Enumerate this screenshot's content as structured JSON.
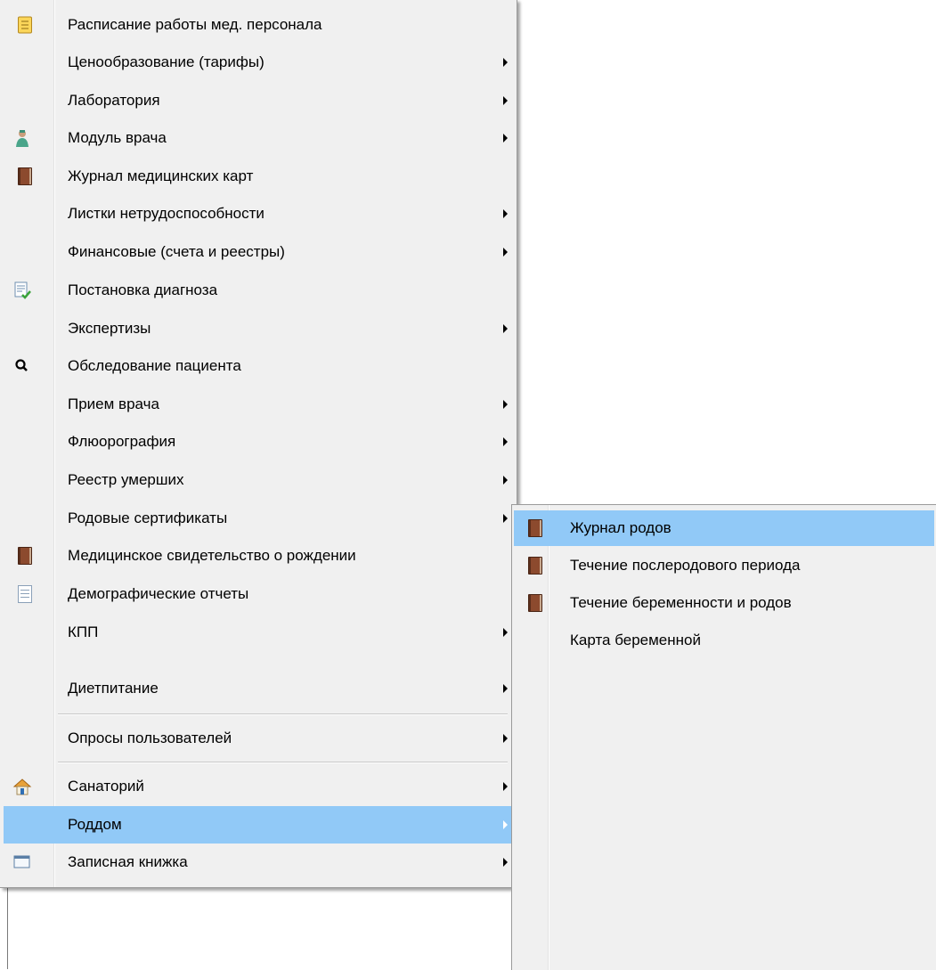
{
  "main_menu": {
    "items": [
      {
        "label": "Расписание работы мед. персонала",
        "icon": "notepad-icon",
        "submenu": false
      },
      {
        "label": "Ценообразование (тарифы)",
        "icon": "",
        "submenu": true
      },
      {
        "label": "Лаборатория",
        "icon": "",
        "submenu": true
      },
      {
        "label": "Модуль врача",
        "icon": "doctor-icon",
        "submenu": true
      },
      {
        "label": "Журнал медицинских карт",
        "icon": "book-icon",
        "submenu": false
      },
      {
        "label": "Листки нетрудоспособности",
        "icon": "",
        "submenu": true
      },
      {
        "label": "Финансовые (счета и реестры)",
        "icon": "",
        "submenu": true
      },
      {
        "label": "Постановка диагноза",
        "icon": "document-check-icon",
        "submenu": false
      },
      {
        "label": "Экспертизы",
        "icon": "",
        "submenu": true
      },
      {
        "label": "Обследование пациента",
        "icon": "magnifier-icon",
        "submenu": false
      },
      {
        "label": "Прием врача",
        "icon": "",
        "submenu": true
      },
      {
        "label": "Флюорография",
        "icon": "",
        "submenu": true
      },
      {
        "label": "Реестр умерших",
        "icon": "",
        "submenu": true
      },
      {
        "label": "Родовые сертификаты",
        "icon": "",
        "submenu": true
      },
      {
        "label": "Медицинское свидетельство о рождении",
        "icon": "book-icon",
        "submenu": false
      },
      {
        "label": "Демографические отчеты",
        "icon": "document-icon",
        "submenu": false
      },
      {
        "label": "КПП",
        "icon": "",
        "submenu": true
      },
      {
        "label": "Диетпитание",
        "icon": "",
        "submenu": true
      },
      {
        "label": "Опросы пользователей",
        "icon": "",
        "submenu": true
      },
      {
        "label": "Санаторий",
        "icon": "house-icon",
        "submenu": true
      },
      {
        "label": "Роддом",
        "icon": "",
        "submenu": true,
        "highlighted": true
      },
      {
        "label": "Записная книжка",
        "icon": "window-icon",
        "submenu": true
      }
    ]
  },
  "sub_menu": {
    "parent": "Роддом",
    "items": [
      {
        "label": "Журнал родов",
        "icon": "book-icon",
        "highlighted": true
      },
      {
        "label": "Течение послеродового периода",
        "icon": "book-icon"
      },
      {
        "label": "Течение беременности и родов",
        "icon": "book-icon"
      },
      {
        "label": "Карта беременной",
        "icon": ""
      }
    ]
  },
  "colors": {
    "menu_background": "#f0f0f0",
    "highlight": "#91c9f7"
  }
}
